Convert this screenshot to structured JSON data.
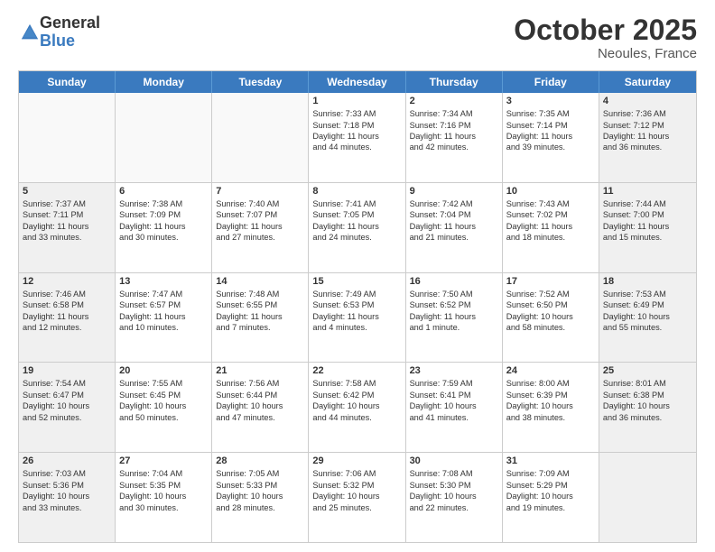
{
  "header": {
    "logo_general": "General",
    "logo_blue": "Blue",
    "month_title": "October 2025",
    "location": "Neoules, France"
  },
  "weekdays": [
    "Sunday",
    "Monday",
    "Tuesday",
    "Wednesday",
    "Thursday",
    "Friday",
    "Saturday"
  ],
  "rows": [
    [
      {
        "day": "",
        "lines": [],
        "empty": true
      },
      {
        "day": "",
        "lines": [],
        "empty": true
      },
      {
        "day": "",
        "lines": [],
        "empty": true
      },
      {
        "day": "1",
        "lines": [
          "Sunrise: 7:33 AM",
          "Sunset: 7:18 PM",
          "Daylight: 11 hours",
          "and 44 minutes."
        ]
      },
      {
        "day": "2",
        "lines": [
          "Sunrise: 7:34 AM",
          "Sunset: 7:16 PM",
          "Daylight: 11 hours",
          "and 42 minutes."
        ]
      },
      {
        "day": "3",
        "lines": [
          "Sunrise: 7:35 AM",
          "Sunset: 7:14 PM",
          "Daylight: 11 hours",
          "and 39 minutes."
        ]
      },
      {
        "day": "4",
        "lines": [
          "Sunrise: 7:36 AM",
          "Sunset: 7:12 PM",
          "Daylight: 11 hours",
          "and 36 minutes."
        ],
        "shaded": true
      }
    ],
    [
      {
        "day": "5",
        "lines": [
          "Sunrise: 7:37 AM",
          "Sunset: 7:11 PM",
          "Daylight: 11 hours",
          "and 33 minutes."
        ],
        "shaded": true
      },
      {
        "day": "6",
        "lines": [
          "Sunrise: 7:38 AM",
          "Sunset: 7:09 PM",
          "Daylight: 11 hours",
          "and 30 minutes."
        ]
      },
      {
        "day": "7",
        "lines": [
          "Sunrise: 7:40 AM",
          "Sunset: 7:07 PM",
          "Daylight: 11 hours",
          "and 27 minutes."
        ]
      },
      {
        "day": "8",
        "lines": [
          "Sunrise: 7:41 AM",
          "Sunset: 7:05 PM",
          "Daylight: 11 hours",
          "and 24 minutes."
        ]
      },
      {
        "day": "9",
        "lines": [
          "Sunrise: 7:42 AM",
          "Sunset: 7:04 PM",
          "Daylight: 11 hours",
          "and 21 minutes."
        ]
      },
      {
        "day": "10",
        "lines": [
          "Sunrise: 7:43 AM",
          "Sunset: 7:02 PM",
          "Daylight: 11 hours",
          "and 18 minutes."
        ]
      },
      {
        "day": "11",
        "lines": [
          "Sunrise: 7:44 AM",
          "Sunset: 7:00 PM",
          "Daylight: 11 hours",
          "and 15 minutes."
        ],
        "shaded": true
      }
    ],
    [
      {
        "day": "12",
        "lines": [
          "Sunrise: 7:46 AM",
          "Sunset: 6:58 PM",
          "Daylight: 11 hours",
          "and 12 minutes."
        ],
        "shaded": true
      },
      {
        "day": "13",
        "lines": [
          "Sunrise: 7:47 AM",
          "Sunset: 6:57 PM",
          "Daylight: 11 hours",
          "and 10 minutes."
        ]
      },
      {
        "day": "14",
        "lines": [
          "Sunrise: 7:48 AM",
          "Sunset: 6:55 PM",
          "Daylight: 11 hours",
          "and 7 minutes."
        ]
      },
      {
        "day": "15",
        "lines": [
          "Sunrise: 7:49 AM",
          "Sunset: 6:53 PM",
          "Daylight: 11 hours",
          "and 4 minutes."
        ]
      },
      {
        "day": "16",
        "lines": [
          "Sunrise: 7:50 AM",
          "Sunset: 6:52 PM",
          "Daylight: 11 hours",
          "and 1 minute."
        ]
      },
      {
        "day": "17",
        "lines": [
          "Sunrise: 7:52 AM",
          "Sunset: 6:50 PM",
          "Daylight: 10 hours",
          "and 58 minutes."
        ]
      },
      {
        "day": "18",
        "lines": [
          "Sunrise: 7:53 AM",
          "Sunset: 6:49 PM",
          "Daylight: 10 hours",
          "and 55 minutes."
        ],
        "shaded": true
      }
    ],
    [
      {
        "day": "19",
        "lines": [
          "Sunrise: 7:54 AM",
          "Sunset: 6:47 PM",
          "Daylight: 10 hours",
          "and 52 minutes."
        ],
        "shaded": true
      },
      {
        "day": "20",
        "lines": [
          "Sunrise: 7:55 AM",
          "Sunset: 6:45 PM",
          "Daylight: 10 hours",
          "and 50 minutes."
        ]
      },
      {
        "day": "21",
        "lines": [
          "Sunrise: 7:56 AM",
          "Sunset: 6:44 PM",
          "Daylight: 10 hours",
          "and 47 minutes."
        ]
      },
      {
        "day": "22",
        "lines": [
          "Sunrise: 7:58 AM",
          "Sunset: 6:42 PM",
          "Daylight: 10 hours",
          "and 44 minutes."
        ]
      },
      {
        "day": "23",
        "lines": [
          "Sunrise: 7:59 AM",
          "Sunset: 6:41 PM",
          "Daylight: 10 hours",
          "and 41 minutes."
        ]
      },
      {
        "day": "24",
        "lines": [
          "Sunrise: 8:00 AM",
          "Sunset: 6:39 PM",
          "Daylight: 10 hours",
          "and 38 minutes."
        ]
      },
      {
        "day": "25",
        "lines": [
          "Sunrise: 8:01 AM",
          "Sunset: 6:38 PM",
          "Daylight: 10 hours",
          "and 36 minutes."
        ],
        "shaded": true
      }
    ],
    [
      {
        "day": "26",
        "lines": [
          "Sunrise: 7:03 AM",
          "Sunset: 5:36 PM",
          "Daylight: 10 hours",
          "and 33 minutes."
        ],
        "shaded": true
      },
      {
        "day": "27",
        "lines": [
          "Sunrise: 7:04 AM",
          "Sunset: 5:35 PM",
          "Daylight: 10 hours",
          "and 30 minutes."
        ]
      },
      {
        "day": "28",
        "lines": [
          "Sunrise: 7:05 AM",
          "Sunset: 5:33 PM",
          "Daylight: 10 hours",
          "and 28 minutes."
        ]
      },
      {
        "day": "29",
        "lines": [
          "Sunrise: 7:06 AM",
          "Sunset: 5:32 PM",
          "Daylight: 10 hours",
          "and 25 minutes."
        ]
      },
      {
        "day": "30",
        "lines": [
          "Sunrise: 7:08 AM",
          "Sunset: 5:30 PM",
          "Daylight: 10 hours",
          "and 22 minutes."
        ]
      },
      {
        "day": "31",
        "lines": [
          "Sunrise: 7:09 AM",
          "Sunset: 5:29 PM",
          "Daylight: 10 hours",
          "and 19 minutes."
        ]
      },
      {
        "day": "",
        "lines": [],
        "empty": true,
        "shaded": true
      }
    ]
  ]
}
